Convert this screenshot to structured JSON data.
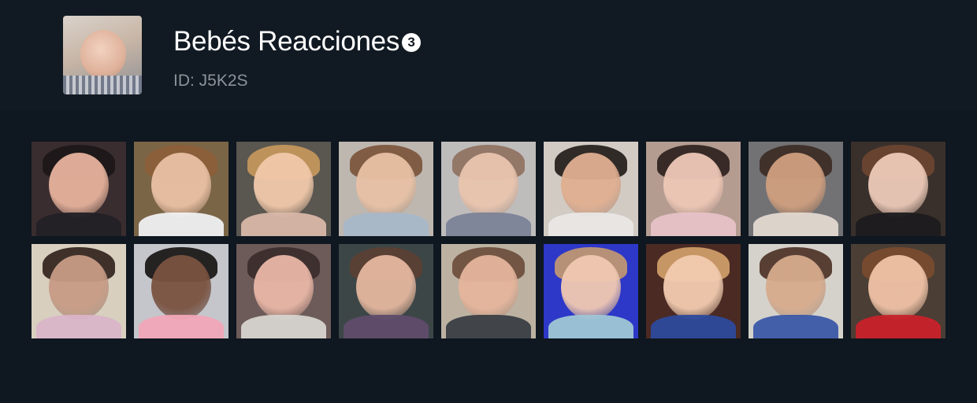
{
  "channel": {
    "name": "Bebés Reacciones",
    "badge": "3",
    "id_text": "ID: J5K2S",
    "avatar_icon": "baby-avatar"
  },
  "stickers": [
    {
      "label": "sticker-1",
      "bg": "#3a2d2f",
      "skin": "#e6b29c",
      "hair": "#1c1618",
      "shirt": "#222026"
    },
    {
      "label": "sticker-2",
      "bg": "#7b6547",
      "skin": "#e9c0a4",
      "hair": "#8c5e38",
      "shirt": "#f0f0f2"
    },
    {
      "label": "sticker-3",
      "bg": "#5a5650",
      "skin": "#f1c9aa",
      "hair": "#c99a5c",
      "shirt": "#d8b7a8"
    },
    {
      "label": "sticker-4",
      "bg": "#bdb7b0",
      "skin": "#e8c1a5",
      "hair": "#7a5238",
      "shirt": "#a8b7c8"
    },
    {
      "label": "sticker-5",
      "bg": "#bfbcbc",
      "skin": "#e9c4ad",
      "hair": "#8e6f5d",
      "shirt": "#7c8397"
    },
    {
      "label": "sticker-6",
      "bg": "#d2cbc4",
      "skin": "#e0ae90",
      "hair": "#1f1916",
      "shirt": "#e9e6e4"
    },
    {
      "label": "sticker-7",
      "bg": "#b49c91",
      "skin": "#eec7b6",
      "hair": "#2a1f1c",
      "shirt": "#e7c2c8"
    },
    {
      "label": "sticker-8",
      "bg": "#727275",
      "skin": "#cf9f7f",
      "hair": "#3b2a22",
      "shirt": "#e2d8d0"
    },
    {
      "label": "sticker-9",
      "bg": "#3a302b",
      "skin": "#edcab8",
      "hair": "#6e4631",
      "shirt": "#1c1b1d"
    },
    {
      "label": "sticker-10",
      "bg": "#d8cfbf",
      "skin": "#c79b85",
      "hair": "#2f1e1a",
      "shirt": "#d9b4c8"
    },
    {
      "label": "sticker-11",
      "bg": "#c4c6cb",
      "skin": "#7a5240",
      "hair": "#141010",
      "shirt": "#f1a7b7"
    },
    {
      "label": "sticker-12",
      "bg": "#6c5b59",
      "skin": "#e8b6a6",
      "hair": "#3a2b2a",
      "shirt": "#d7d4cf"
    },
    {
      "label": "sticker-13",
      "bg": "#3c4647",
      "skin": "#e4b79f",
      "hair": "#5b3f33",
      "shirt": "#5f4c6b"
    },
    {
      "label": "sticker-14",
      "bg": "#bdb2a2",
      "skin": "#e5b59c",
      "hair": "#6a4a3a",
      "shirt": "#3a3f45"
    },
    {
      "label": "sticker-15",
      "bg": "#2d37c8",
      "skin": "#f1c9b2",
      "hair": "#c79a6f",
      "shirt": "#9fc6d6"
    },
    {
      "label": "sticker-16",
      "bg": "#4b2a23",
      "skin": "#f2cbb0",
      "hair": "#d4a26b",
      "shirt": "#2d4a9c"
    },
    {
      "label": "sticker-17",
      "bg": "#d5d2cb",
      "skin": "#d7ab8d",
      "hair": "#4a2f22",
      "shirt": "#3c59a8"
    },
    {
      "label": "sticker-18",
      "bg": "#4a3e35",
      "skin": "#f0c2a6",
      "hair": "#7a4b2d",
      "shirt": "#c8222a"
    }
  ]
}
